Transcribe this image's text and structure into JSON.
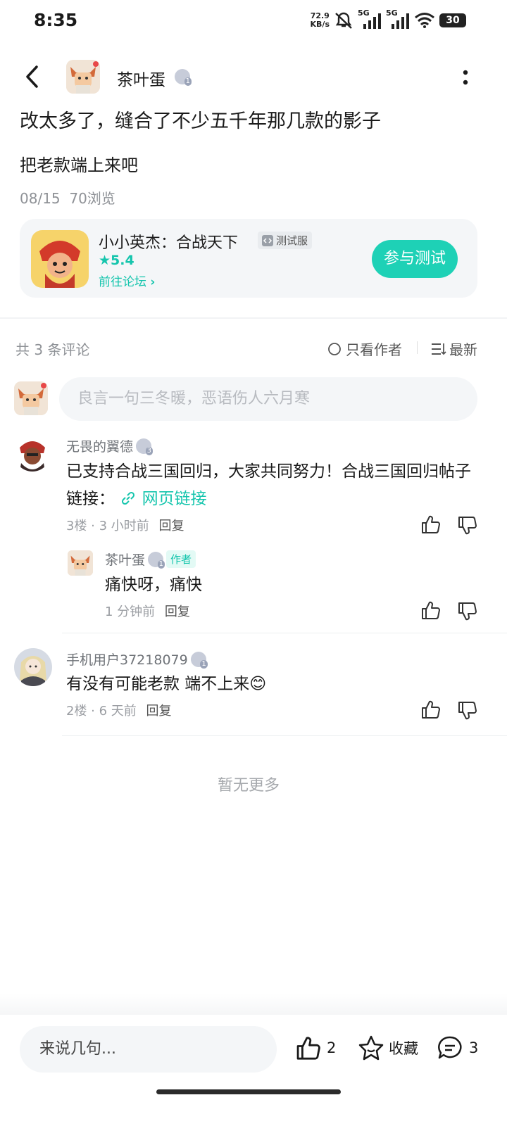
{
  "status_bar": {
    "time": "8:35",
    "net_speed_value": "72.9",
    "net_speed_unit": "KB/s",
    "signal1": "5G",
    "signal2": "5G",
    "battery": "30"
  },
  "header": {
    "username": "茶叶蛋",
    "back_icon": "back-arrow-icon",
    "more_icon": "more-vertical-icon"
  },
  "post": {
    "title": "改太多了，缝合了不少五千年那几款的影子",
    "body": "把老款端上来吧",
    "date": "08/15",
    "views": "70浏览"
  },
  "game_card": {
    "name": "小小英杰：合战天下",
    "badge": "测试服",
    "rating": "5.4",
    "forum_link": "前往论坛",
    "join_label": "参与测试"
  },
  "comments_header": {
    "count_label": "共 3 条评论",
    "author_only": "只看作者",
    "sort_label": "最新"
  },
  "comment_input": {
    "placeholder": "良言一句三冬暖，恶语伤人六月寒"
  },
  "comments": [
    {
      "user": "无畏的翼德",
      "level": "3",
      "text": "已支持合战三国回归，大家共同努力！合战三国回归帖子链接：",
      "link_text": "网页链接",
      "floor": "3楼",
      "time": "3 小时前",
      "reply_label": "回复",
      "replies": [
        {
          "user": "茶叶蛋",
          "level": "1",
          "tag": "作者",
          "text": "痛快呀，痛快",
          "time": "1 分钟前",
          "reply_label": "回复"
        }
      ]
    },
    {
      "user": "手机用户37218079",
      "level": "1",
      "text": "有没有可能老款 端不上来😊",
      "floor": "2楼",
      "time": "6 天前",
      "reply_label": "回复"
    }
  ],
  "no_more": "暂无更多",
  "bottom_bar": {
    "input_placeholder": "来说几句...",
    "like_count": "2",
    "favorite_label": "收藏",
    "comment_count": "3"
  },
  "colors": {
    "accent": "#1ed1b6",
    "text": "#1a1a1a",
    "muted": "#8e9196"
  }
}
